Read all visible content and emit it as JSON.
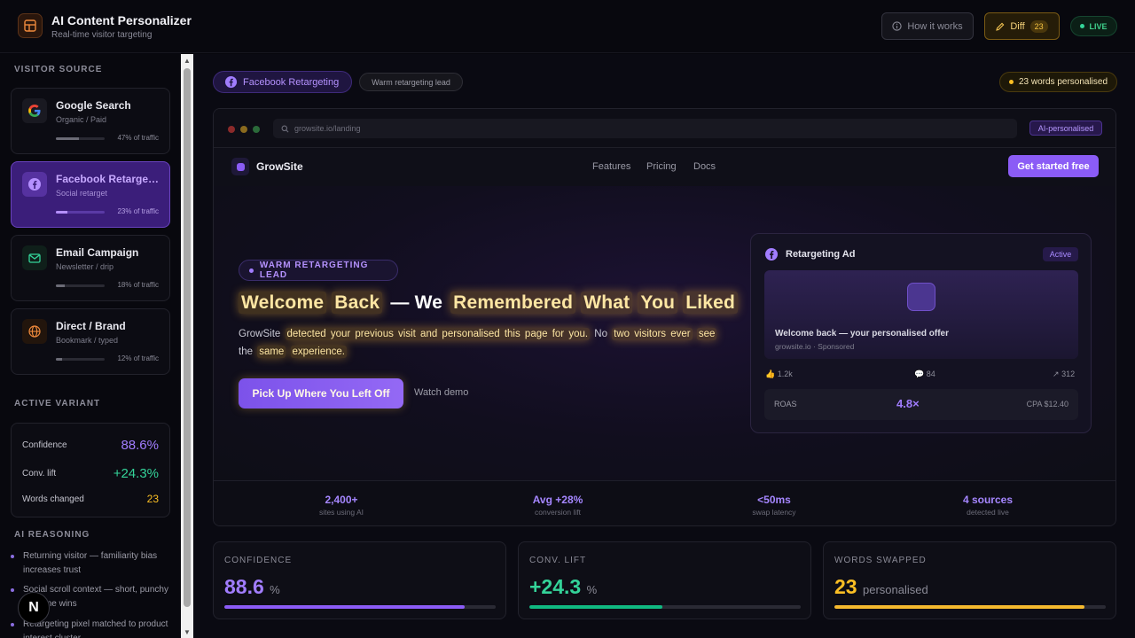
{
  "header": {
    "title": "AI Content Personalizer",
    "subtitle": "Real-time visitor targeting",
    "how_label": "How it works",
    "diff_label": "Diff",
    "diff_count": "23",
    "live_label": "LIVE"
  },
  "sidebar": {
    "visitor_source_heading": "VISITOR SOURCE",
    "sources": [
      {
        "name": "Google Search",
        "type": "Organic / Paid",
        "share": 0.47,
        "pct_label": "47% of traffic",
        "icon": "google-icon"
      },
      {
        "name": "Facebook Retargeting",
        "type": "Social retarget",
        "share": 0.23,
        "pct_label": "23% of traffic",
        "icon": "facebook-icon",
        "active": true
      },
      {
        "name": "Email Campaign",
        "type": "Newsletter / drip",
        "share": 0.18,
        "pct_label": "18% of traffic",
        "icon": "mail-icon"
      },
      {
        "name": "Direct / Brand",
        "type": "Bookmark / typed",
        "share": 0.12,
        "pct_label": "12% of traffic",
        "icon": "globe-icon"
      }
    ],
    "active_variant_heading": "ACTIVE VARIANT",
    "variant": {
      "confidence_label": "Confidence",
      "confidence_value": "88.6%",
      "lift_label": "Conv. lift",
      "lift_value": "+24.3%",
      "words_label": "Words changed",
      "words_value": "23"
    },
    "reasoning_heading": "AI REASONING",
    "reasoning": [
      "Returning visitor — familiarity bias increases trust",
      "Social scroll context — short, punchy headline wins",
      "Retargeting pixel matched to product interest cluster"
    ],
    "badge_letter": "N"
  },
  "main": {
    "source_pill": "Facebook Retargeting",
    "lead_pill": "Warm retargeting lead",
    "words_pill": "23 words personalised",
    "browser": {
      "url": "growsite.io/landing",
      "ai_chip": "AI-personalised",
      "site_name": "GrowSite",
      "nav": [
        "Features",
        "Pricing",
        "Docs"
      ],
      "nav_cta": "Get started free",
      "warm_pill": "WARM RETARGETING LEAD",
      "headline": [
        "Welcome",
        "Back",
        "— We",
        "Remembered",
        "What",
        "You",
        "Liked"
      ],
      "sub_parts": [
        "GrowSite",
        "detected your previous visit and personalised this page for you.",
        "No",
        "two visitors ever",
        "see",
        "the",
        "same",
        "experience."
      ],
      "hero_cta": "Pick Up Where You Left Off",
      "watch_demo": "Watch demo",
      "ad": {
        "title": "Retargeting Ad",
        "status": "Active",
        "headline": "Welcome back — your personalised offer",
        "source": "growsite.io · Sponsored",
        "likes": "1.2k",
        "comments": "84",
        "shares": "312",
        "roas_label": "ROAS",
        "roas_value": "4.8×",
        "cpa": "CPA $12.40"
      },
      "stats": [
        {
          "value": "2,400+",
          "label": "sites using AI"
        },
        {
          "value": "Avg +28%",
          "label": "conversion lift"
        },
        {
          "value": "<50ms",
          "label": "swap latency"
        },
        {
          "value": "4 sources",
          "label": "detected live"
        }
      ]
    },
    "metrics": [
      {
        "label": "CONFIDENCE",
        "value": "88.6",
        "unit": "%",
        "fraction": 0.886,
        "color": "#a17dff",
        "bar": "#8b5cf6"
      },
      {
        "label": "CONV. LIFT",
        "value": "+24.3",
        "unit": "%",
        "fraction": 0.49,
        "color": "#34d399",
        "bar": "#10b981"
      },
      {
        "label": "WORDS SWAPPED",
        "value": "23",
        "unit": "personalised",
        "fraction": 0.92,
        "color": "#fbbf24",
        "bar": "#f5b92e"
      }
    ]
  }
}
